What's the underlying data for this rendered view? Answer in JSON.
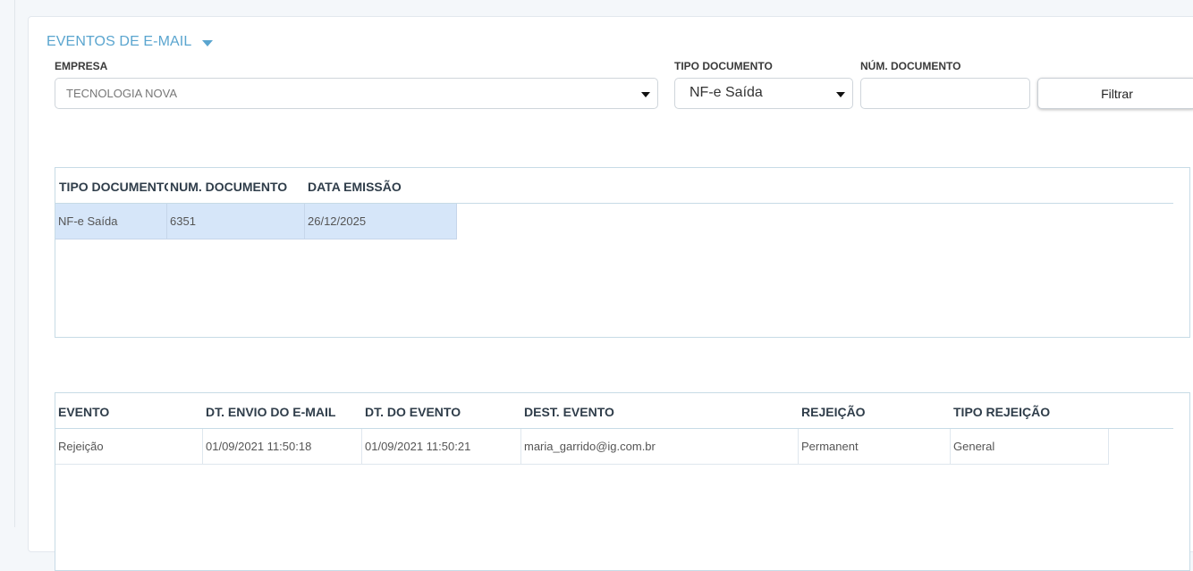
{
  "panel": {
    "title": "EVENTOS DE E-MAIL"
  },
  "filters": {
    "empresa_label": "EMPRESA",
    "empresa_value": "TECNOLOGIA NOVA",
    "tipo_documento_label": "TIPO DOCUMENTO",
    "tipo_documento_value": "NF-e Saída",
    "num_documento_label": "NÚM. DOCUMENTO",
    "num_documento_value": "",
    "filter_button_label": "Filtrar"
  },
  "documents_grid": {
    "headers": [
      "TIPO DOCUMENTO",
      "NUM. DOCUMENTO",
      "DATA EMISSÃO"
    ],
    "rows": [
      [
        "NF-e Saída",
        "6351",
        "26/12/2025"
      ]
    ]
  },
  "events_grid": {
    "headers": [
      "EVENTO",
      "DT. ENVIO DO E-MAIL",
      "DT. DO EVENTO",
      "DEST. EVENTO",
      "REJEIÇÃO",
      "TIPO REJEIÇÃO"
    ],
    "rows": [
      [
        "Rejeição",
        "01/09/2021 11:50:18",
        "01/09/2021 11:50:21",
        "maria_garrido@ig.com.br",
        "Permanent",
        "General"
      ]
    ]
  },
  "colors": {
    "accent": "#5aa5cf",
    "selected_row": "#d6e6f9"
  }
}
